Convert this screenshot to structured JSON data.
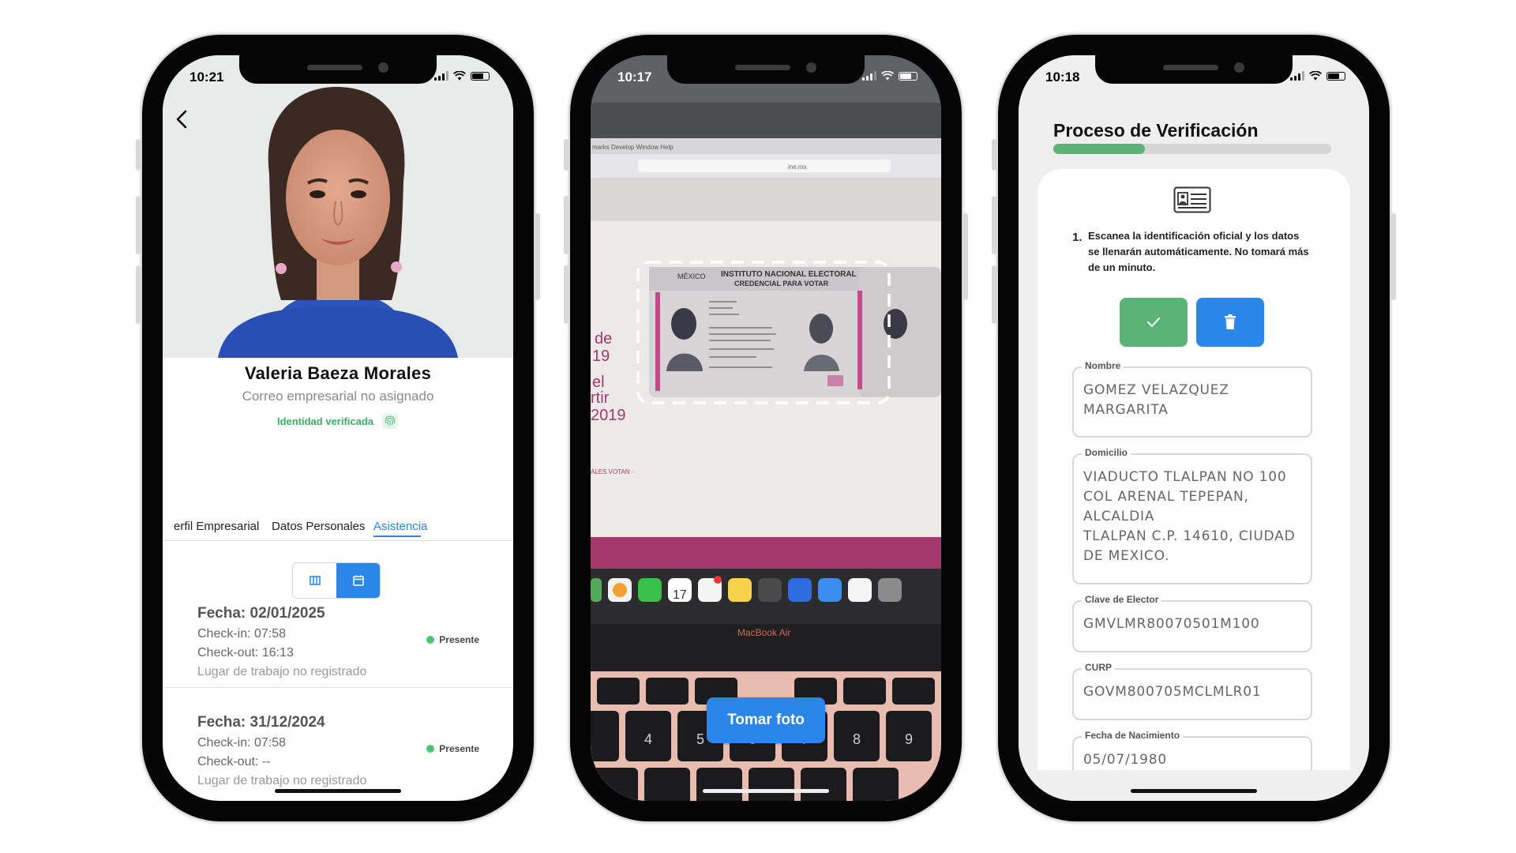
{
  "phone1": {
    "time": "10:21",
    "name": "Valeria Baeza Morales",
    "email": "Correo empresarial no asignado",
    "verified": "Identidad verificada",
    "tabs": [
      {
        "label": "erfil Empresarial"
      },
      {
        "label": "Datos Personales"
      },
      {
        "label": "Asistencia"
      }
    ],
    "records": [
      {
        "date": "Fecha: 02/01/2025",
        "checkin": "Check-in: 07:58",
        "checkout": "Check-out: 16:13",
        "place": "Lugar de trabajo no registrado",
        "status": "Presente"
      },
      {
        "date": "Fecha: 31/12/2024",
        "checkin": "Check-in: 07:58",
        "checkout": "Check-out: --",
        "place": "Lugar de trabajo no registrado",
        "status": "Presente"
      }
    ]
  },
  "phone2": {
    "time": "10:17",
    "take_photo": "Tomar foto",
    "menu": "marks   Develop   Window   Help",
    "url": "ine.mx",
    "laptop_label": "MacBook Air",
    "calendar_day": "17",
    "card_title_1": "INSTITUTO NACIONAL ELECTORAL",
    "card_title_2": "CREDENCIAL PARA VOTAR",
    "card_country": "MÉXICO",
    "page_text_1": "de",
    "page_text_2": "19",
    "page_text_3": "el",
    "page_text_4": "rtir",
    "page_text_5": "2019",
    "page_text_6": "ALES VOTAN ·"
  },
  "phone3": {
    "time": "10:18",
    "title": "Proceso de Verificación",
    "progress": 0.33,
    "step_number": "1.",
    "instruction": "Escanea la identificación oficial y los datos se llenarán automáticamente. No tomará más de un minuto.",
    "fields": [
      {
        "label": "Nombre",
        "value": "GOMEZ VELAZQUEZ\nMARGARITA"
      },
      {
        "label": "Domicilio",
        "value": "VIADUCTO TLALPAN NO 100\nCOL ARENAL TEPEPAN,\nALCALDIA\nTLALPAN C.P. 14610, CIUDAD\nDE MEXICO."
      },
      {
        "label": "Clave de Elector",
        "value": "GMVLMR80070501M100"
      },
      {
        "label": "CURP",
        "value": "GOVM800705MCLMLR01"
      },
      {
        "label": "Fecha de Nacimiento",
        "value": "05/07/1980"
      }
    ],
    "colors": {
      "green": "#5cb377",
      "blue": "#2a86e8"
    }
  }
}
